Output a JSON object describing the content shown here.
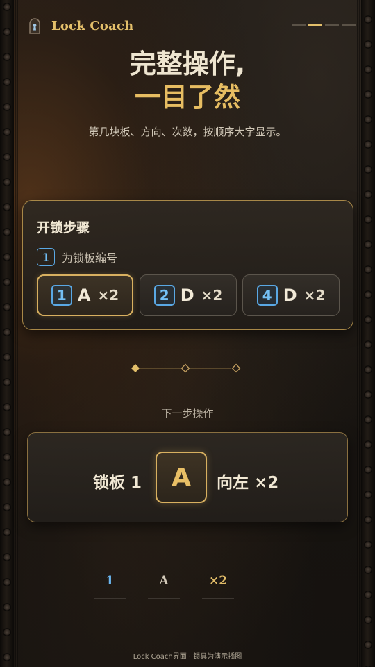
{
  "app": {
    "name": "Lock Coach",
    "logo_icon": "keyhole-lock-icon",
    "accent_color": "#e3bf6a"
  },
  "pager": {
    "pages": 4,
    "current": 2
  },
  "headline": {
    "line1": "完整操作,",
    "line2": "一目了然"
  },
  "subtitle": "第几块板、方向、次数，按顺序大字显示。",
  "steps": {
    "title": "开锁步骤",
    "legend": {
      "badge": "1",
      "text": "为锁板编号"
    },
    "items": [
      {
        "plate": "1",
        "direction": "A",
        "count": "×2",
        "active": true
      },
      {
        "plate": "2",
        "direction": "D",
        "count": "×2",
        "active": false
      },
      {
        "plate": "4",
        "direction": "D",
        "count": "×2",
        "active": false
      }
    ]
  },
  "progress": {
    "total": 3,
    "current": 1
  },
  "next": {
    "label": "下一步操作",
    "board_text": "锁板 1",
    "key": "A",
    "direction_text": "向左 ×2"
  },
  "triad": {
    "plate": "1",
    "key": "A",
    "count": "×2"
  },
  "footer": "Lock Coach界面 · 锁具为演示插图"
}
